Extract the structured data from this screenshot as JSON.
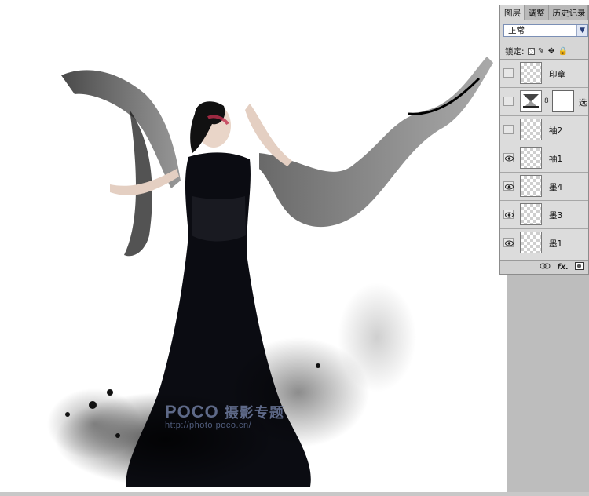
{
  "watermark": {
    "brand": "POCO",
    "subtitle": "摄影专题",
    "url": "http://photo.poco.cn/"
  },
  "layers_panel": {
    "tabs": [
      {
        "label": "图层",
        "active": true
      },
      {
        "label": "调整",
        "active": false
      },
      {
        "label": "历史记录",
        "active": false
      }
    ],
    "blend_mode": "正常",
    "lock_label": "锁定:",
    "layers": [
      {
        "name": "印章",
        "visible": false,
        "type": "pixel"
      },
      {
        "name": "选",
        "visible": false,
        "type": "adjustment"
      },
      {
        "name": "袖2",
        "visible": false,
        "type": "pixel"
      },
      {
        "name": "袖1",
        "visible": true,
        "type": "pixel"
      },
      {
        "name": "墨4",
        "visible": true,
        "type": "pixel"
      },
      {
        "name": "墨3",
        "visible": true,
        "type": "pixel"
      },
      {
        "name": "墨1",
        "visible": true,
        "type": "pixel"
      }
    ],
    "footer_buttons": [
      "link-icon",
      "fx",
      "mask-icon"
    ],
    "fx_label": "fx."
  },
  "colors": {
    "panel_bg": "#d6d6d6",
    "workspace": "#bdbdbd",
    "watermark": "#6d7a9e"
  }
}
